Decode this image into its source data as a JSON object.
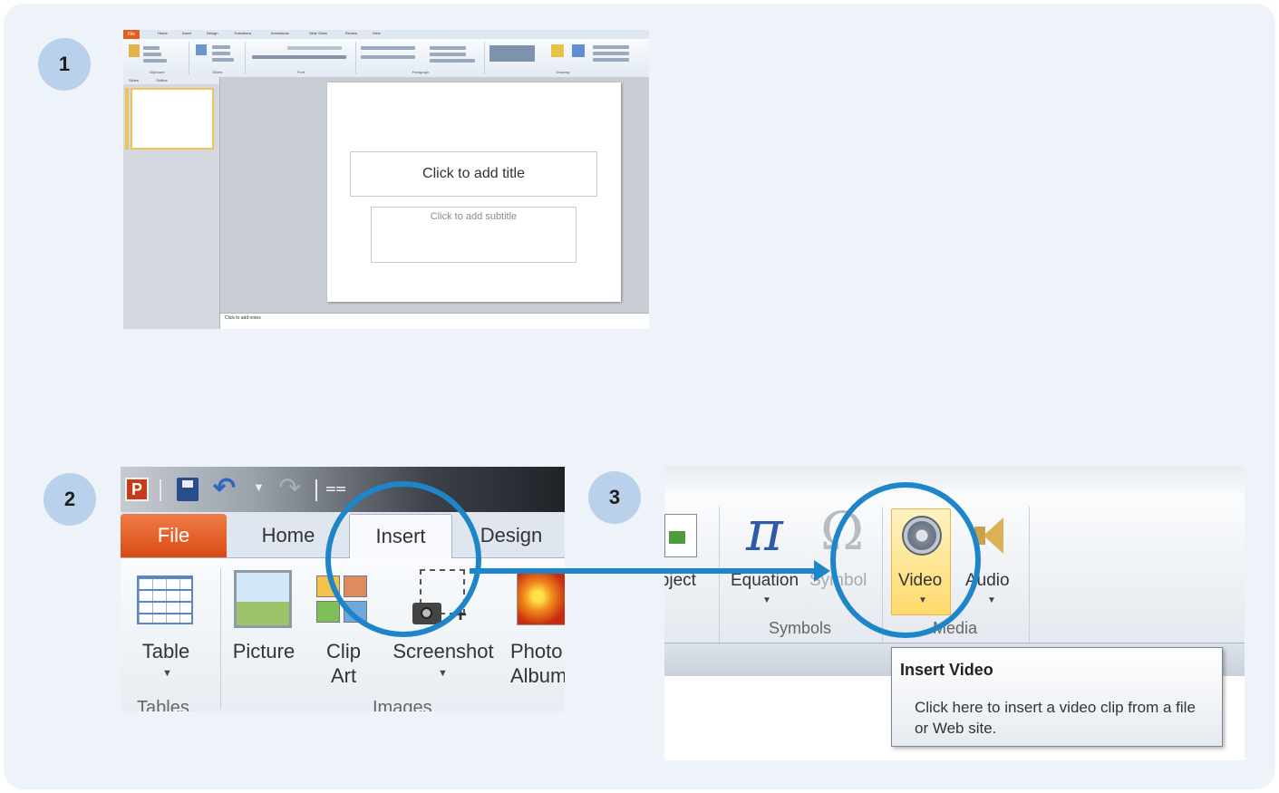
{
  "steps": {
    "step1": "1",
    "step2": "2",
    "step3": "3"
  },
  "screenshot1": {
    "file_tab": "File",
    "tabs": [
      "Home",
      "Insert",
      "Design",
      "Transitions",
      "Animations",
      "Slide Show",
      "Review",
      "View"
    ],
    "groups": [
      "Clipboard",
      "Slides",
      "Font",
      "Paragraph",
      "Drawing"
    ],
    "pane_tabs": [
      "Slides",
      "Outline"
    ],
    "slide_title_placeholder": "Click to add title",
    "slide_subtitle_placeholder": "Click to add subtitle",
    "notes_placeholder": "Click to add notes"
  },
  "screenshot2": {
    "app_icon_letter": "P",
    "file_tab": "File",
    "tabs": [
      "Home",
      "Insert",
      "Design"
    ],
    "buttons": {
      "table": "Table",
      "picture": "Picture",
      "clip_art_line1": "Clip",
      "clip_art_line2": "Art",
      "screenshot": "Screenshot",
      "photo_album_line1": "Photo",
      "photo_album_line2": "Album"
    },
    "groups": {
      "tables": "Tables",
      "images": "Images"
    }
  },
  "screenshot3": {
    "buttons": {
      "object": "Object",
      "equation": "Equation",
      "symbol": "Symbol",
      "video": "Video",
      "audio": "Audio"
    },
    "groups": {
      "symbols": "Symbols",
      "media": "Media"
    },
    "tooltip": {
      "title": "Insert Video",
      "body": "Click here to insert a video clip from a file or Web site."
    }
  },
  "colors": {
    "badge": "#b9d1ea",
    "highlight_circle": "#1f85c9",
    "file_tab": "#d94a14"
  }
}
